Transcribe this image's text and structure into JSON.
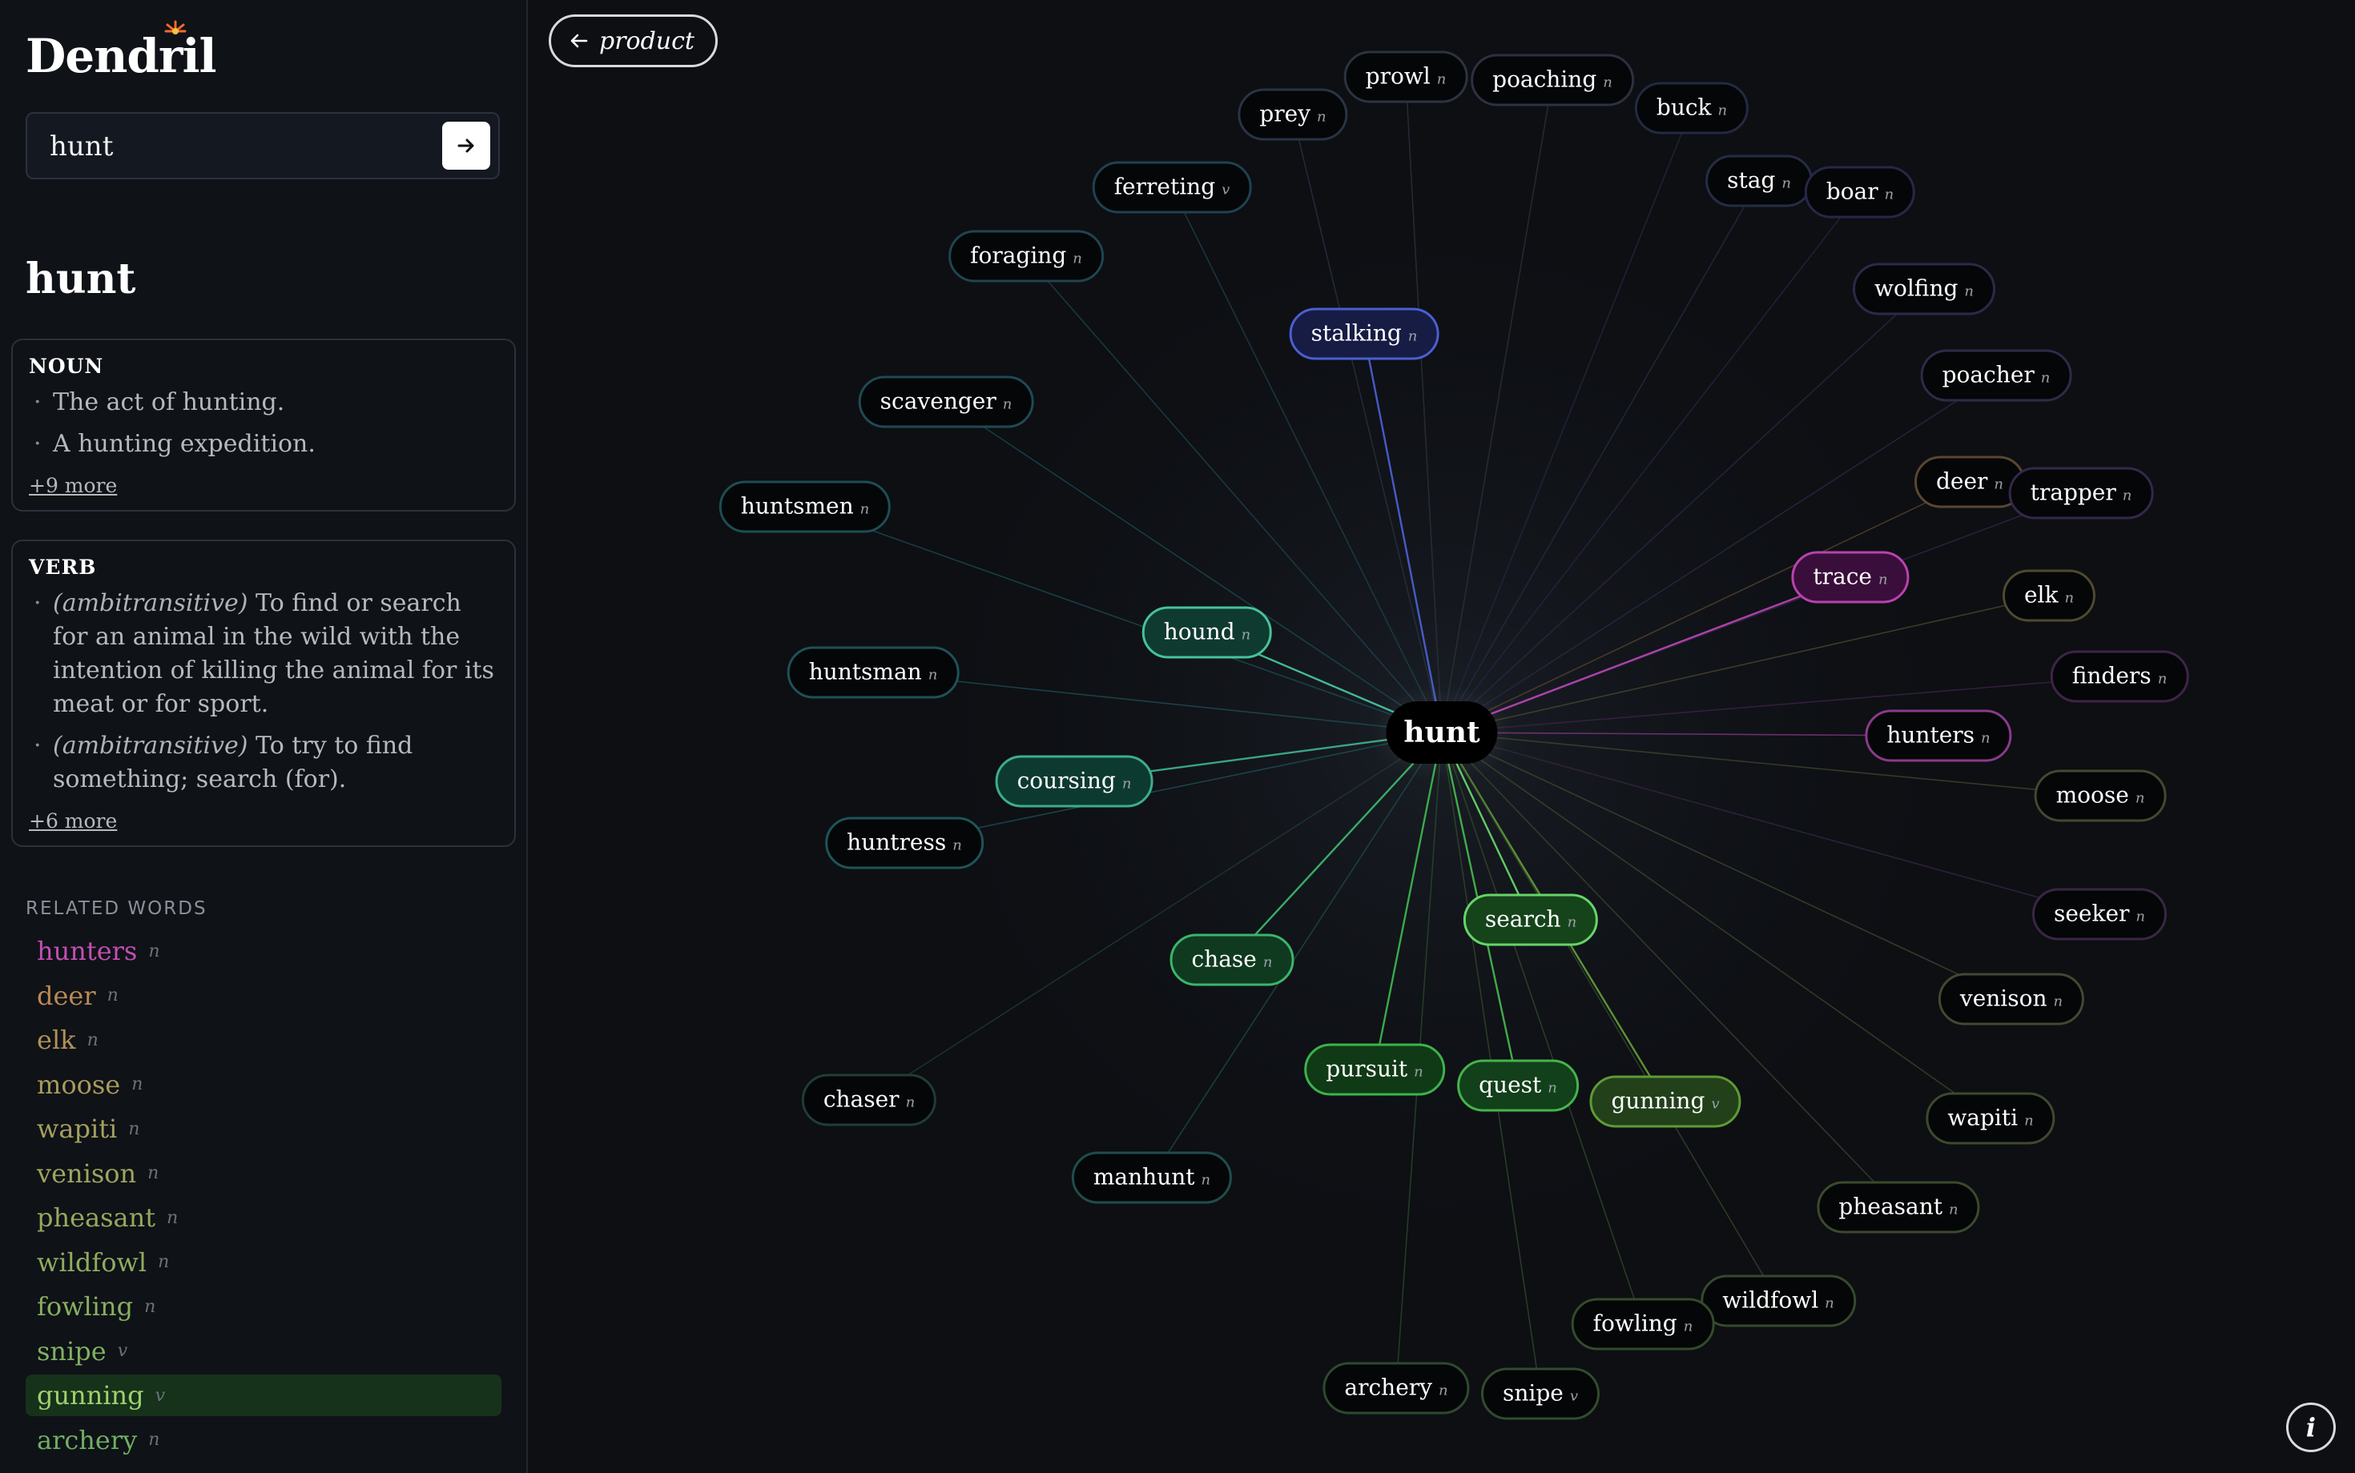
{
  "app": {
    "logo": "Dendril"
  },
  "search": {
    "value": "hunt"
  },
  "word": "hunt",
  "definitions": [
    {
      "pos": "NOUN",
      "senses": [
        {
          "gloss": "",
          "text": "The act of hunting."
        },
        {
          "gloss": "",
          "text": "A hunting expedition."
        }
      ],
      "more": "+9 more"
    },
    {
      "pos": "VERB",
      "senses": [
        {
          "gloss": "(ambitransitive)",
          "text": " To find or search for an animal in the wild with the intention of killing the animal for its meat or for sport."
        },
        {
          "gloss": "(ambitransitive)",
          "text": " To try to find something; search (for)."
        }
      ],
      "more": "+6 more"
    }
  ],
  "related": {
    "heading": "RELATED WORDS",
    "items": [
      {
        "word": "hunters",
        "pos": "n",
        "color": "#c24fb2",
        "active": false
      },
      {
        "word": "deer",
        "pos": "n",
        "color": "#b98a54",
        "active": false
      },
      {
        "word": "elk",
        "pos": "n",
        "color": "#b09258",
        "active": false
      },
      {
        "word": "moose",
        "pos": "n",
        "color": "#a99a5b",
        "active": false
      },
      {
        "word": "wapiti",
        "pos": "n",
        "color": "#a3a05c",
        "active": false
      },
      {
        "word": "venison",
        "pos": "n",
        "color": "#9ea55d",
        "active": false
      },
      {
        "word": "pheasant",
        "pos": "n",
        "color": "#97a85e",
        "active": false
      },
      {
        "word": "wildfowl",
        "pos": "n",
        "color": "#90ab5f",
        "active": false
      },
      {
        "word": "fowling",
        "pos": "n",
        "color": "#88ae60",
        "active": false
      },
      {
        "word": "snipe",
        "pos": "v",
        "color": "#80b061",
        "active": false
      },
      {
        "word": "gunning",
        "pos": "v",
        "color": "#9fd06e",
        "active": true
      },
      {
        "word": "archery",
        "pos": "n",
        "color": "#6fae63",
        "active": false
      }
    ]
  },
  "nav": {
    "back_label": "product",
    "info_label": "i"
  },
  "graph": {
    "center": "hunt",
    "nodes": [
      {
        "word": "prowl",
        "pos": "n",
        "color": "#2c3340",
        "fill": "#050608",
        "strong": false
      },
      {
        "word": "poaching",
        "pos": "n",
        "color": "#2b3140",
        "fill": "#050608",
        "strong": false
      },
      {
        "word": "prey",
        "pos": "n",
        "color": "#283444",
        "fill": "#050608",
        "strong": false
      },
      {
        "word": "buck",
        "pos": "n",
        "color": "#232a42",
        "fill": "#050608",
        "strong": false
      },
      {
        "word": "ferreting",
        "pos": "v",
        "color": "#1f4150",
        "fill": "#050608",
        "strong": false
      },
      {
        "word": "stag",
        "pos": "n",
        "color": "#242d45",
        "fill": "#050608",
        "strong": false
      },
      {
        "word": "boar",
        "pos": "n",
        "color": "#272746",
        "fill": "#050608",
        "strong": false
      },
      {
        "word": "foraging",
        "pos": "n",
        "color": "#1f4452",
        "fill": "#050608",
        "strong": false
      },
      {
        "word": "stalking",
        "pos": "n",
        "color": "#4a5fd0",
        "fill": "#161c44",
        "strong": true
      },
      {
        "word": "wolfing",
        "pos": "n",
        "color": "#2a2a48",
        "fill": "#050608",
        "strong": false
      },
      {
        "word": "poacher",
        "pos": "n",
        "color": "#2e2a48",
        "fill": "#050608",
        "strong": false
      },
      {
        "word": "scavenger",
        "pos": "n",
        "color": "#1e4a55",
        "fill": "#050608",
        "strong": false
      },
      {
        "word": "deer",
        "pos": "n",
        "color": "#5a4630",
        "fill": "#050608",
        "strong": false
      },
      {
        "word": "trapper",
        "pos": "n",
        "color": "#33284a",
        "fill": "#050608",
        "strong": false
      },
      {
        "word": "huntsmen",
        "pos": "n",
        "color": "#1d4d55",
        "fill": "#050608",
        "strong": false
      },
      {
        "word": "trace",
        "pos": "n",
        "color": "#b643b0",
        "fill": "#3a0e3a",
        "strong": true
      },
      {
        "word": "elk",
        "pos": "n",
        "color": "#4f4a2e",
        "fill": "#050608",
        "strong": false
      },
      {
        "word": "hound",
        "pos": "n",
        "color": "#45c39a",
        "fill": "#0f3a30",
        "strong": true
      },
      {
        "word": "finders",
        "pos": "n",
        "color": "#3e2448",
        "fill": "#050608",
        "strong": false
      },
      {
        "word": "huntsman",
        "pos": "n",
        "color": "#1d5158",
        "fill": "#050608",
        "strong": false
      },
      {
        "word": "hunters",
        "pos": "n",
        "color": "#8a3a8a",
        "fill": "#050608",
        "strong": false
      },
      {
        "word": "coursing",
        "pos": "n",
        "color": "#3cae8c",
        "fill": "#0d3a30",
        "strong": true
      },
      {
        "word": "moose",
        "pos": "n",
        "color": "#3f4a30",
        "fill": "#050608",
        "strong": false
      },
      {
        "word": "huntress",
        "pos": "n",
        "color": "#1e5458",
        "fill": "#050608",
        "strong": false
      },
      {
        "word": "search",
        "pos": "n",
        "color": "#66d46a",
        "fill": "#16441a",
        "strong": true
      },
      {
        "word": "seeker",
        "pos": "n",
        "color": "#3a2645",
        "fill": "#050608",
        "strong": false
      },
      {
        "word": "chase",
        "pos": "n",
        "color": "#3bb56c",
        "fill": "#0f3a20",
        "strong": true
      },
      {
        "word": "venison",
        "pos": "n",
        "color": "#3f4a30",
        "fill": "#050608",
        "strong": false
      },
      {
        "word": "pursuit",
        "pos": "n",
        "color": "#3cb24e",
        "fill": "#103a16",
        "strong": true
      },
      {
        "word": "chaser",
        "pos": "n",
        "color": "#203c36",
        "fill": "#050608",
        "strong": false
      },
      {
        "word": "quest",
        "pos": "n",
        "color": "#45b44c",
        "fill": "#12401a",
        "strong": true
      },
      {
        "word": "gunning",
        "pos": "v",
        "color": "#5f9a36",
        "fill": "#22401a",
        "strong": true
      },
      {
        "word": "wapiti",
        "pos": "n",
        "color": "#3d4a2e",
        "fill": "#050608",
        "strong": false
      },
      {
        "word": "manhunt",
        "pos": "n",
        "color": "#1f4e4a",
        "fill": "#050608",
        "strong": false
      },
      {
        "word": "pheasant",
        "pos": "n",
        "color": "#3a4a2c",
        "fill": "#050608",
        "strong": false
      },
      {
        "word": "wildfowl",
        "pos": "n",
        "color": "#354a2c",
        "fill": "#050608",
        "strong": false
      },
      {
        "word": "fowling",
        "pos": "n",
        "color": "#334b2c",
        "fill": "#050608",
        "strong": false
      },
      {
        "word": "archery",
        "pos": "n",
        "color": "#2e4a2e",
        "fill": "#050608",
        "strong": false
      },
      {
        "word": "snipe",
        "pos": "v",
        "color": "#314b2e",
        "fill": "#050608",
        "strong": false
      }
    ]
  }
}
